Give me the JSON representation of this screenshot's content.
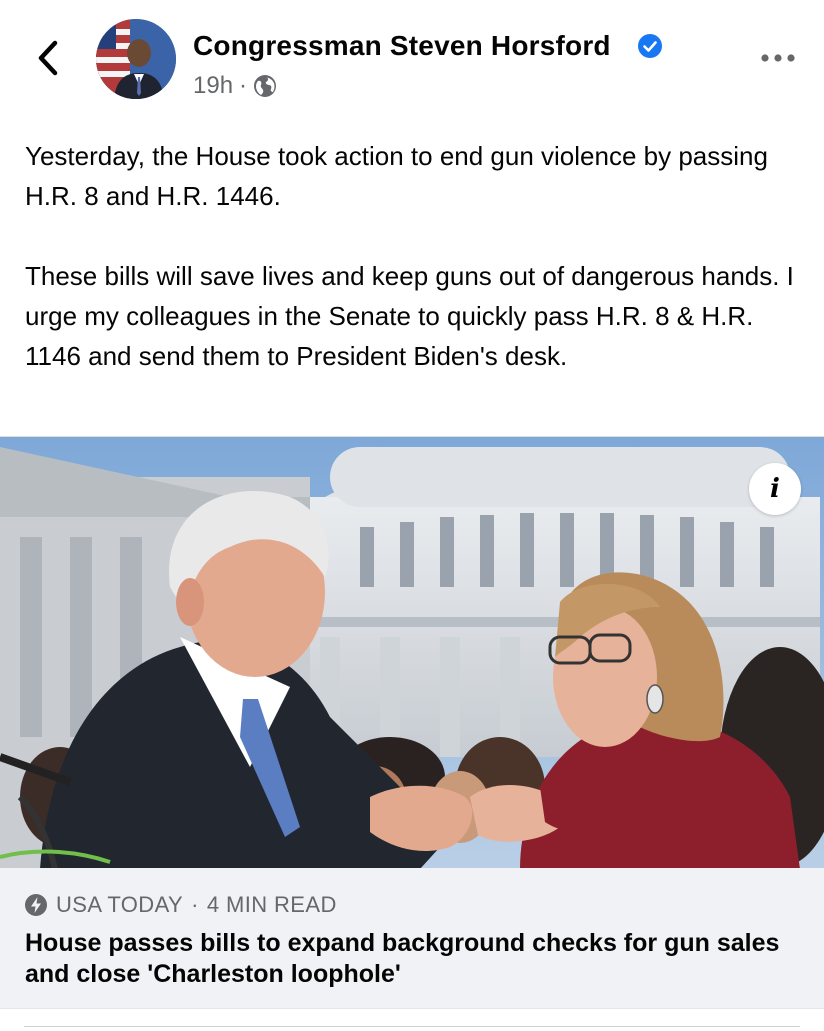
{
  "header": {
    "author_name": "Congressman Steven Horsford",
    "timestamp": "19h",
    "separator": "·",
    "privacy_icon": "globe-icon",
    "verified_icon": "verified-badge-icon",
    "verified_color": "#1877f2"
  },
  "post": {
    "paragraphs": [
      "Yesterday, the House took action to end gun violence by passing H.R. 8 and H.R. 1446.",
      "These bills will save lives and keep guns out of dangerous hands. I urge my colleagues in the Senate to quickly pass H.R. 8 & H.R. 1146 and send them to President Biden's desk."
    ]
  },
  "link_card": {
    "info_label": "i",
    "source_icon": "bolt-icon",
    "source": "USA TODAY",
    "separator": "·",
    "read_time": "4 MIN READ",
    "title": "House passes bills to expand background checks for gun sales and close 'Charleston loophole'"
  },
  "colors": {
    "text_primary": "#050505",
    "text_secondary": "#65676b",
    "card_background": "#f0f2f5",
    "accent": "#1877f2"
  }
}
